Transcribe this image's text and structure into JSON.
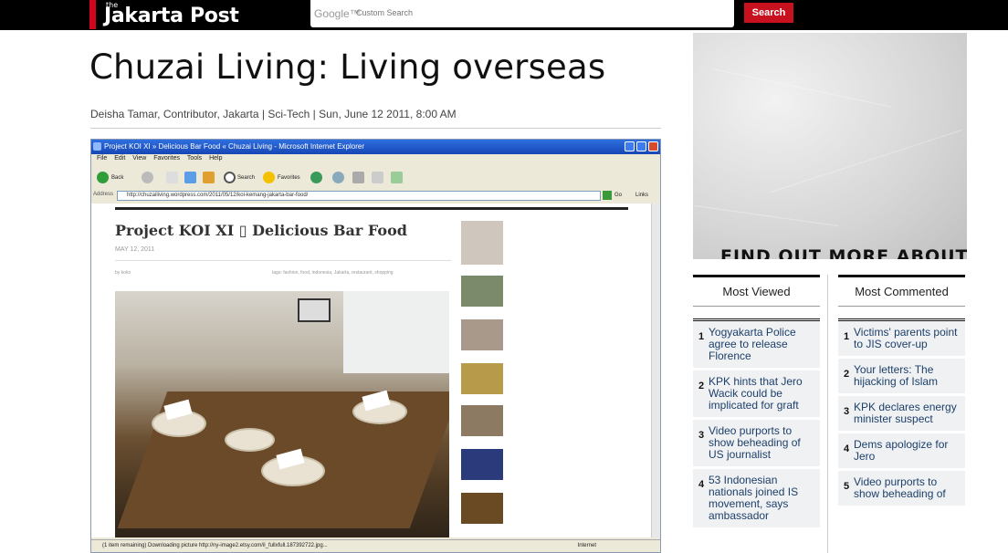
{
  "header": {
    "logo_the": "the",
    "logo_name": "Jakarta Post",
    "search_brand": "Google™",
    "search_placeholder": "Custom Search",
    "search_button": "Search",
    "accent": "#d1061c"
  },
  "article": {
    "title": "Chuzai Living: Living overseas",
    "byline": "Deisha Tamar, Contributor, Jakarta | Sci-Tech | Sun, June 12 2011, 8:00 AM"
  },
  "screenshot": {
    "window_title": "Project KOI XI » Delicious Bar Food « Chuzai Living - Microsoft Internet Explorer",
    "menu": "File Edit View Favorites Tools Help",
    "toolbar": {
      "back": "Back",
      "search": "Search",
      "favorites": "Favorites"
    },
    "address_label": "Address",
    "address": "http://chuzailiving.wordpress.com/2011/05/12/koi-kemang-jakarta-bar-food/",
    "go_label": "Go",
    "links_label": "Links",
    "post_title": "Project KOI XI ▯ Delicious Bar Food",
    "post_date": "MAY 12, 2011",
    "post_by": "by koko",
    "post_tags": "tags: fashion, food, indonesia, Jakarta, restaurant, shopping",
    "status": "(1 item remaining) Downloading picture http://ny-image2.etsy.com/il_fullxfull.187392722.jpg...",
    "status_zone": "Internet"
  },
  "ad": {
    "tagline": "FIND OUT MORE ABOUT"
  },
  "most_viewed": {
    "heading": "Most Viewed",
    "items": [
      {
        "num": "1",
        "text": "Yogyakarta Police agree to release Florence"
      },
      {
        "num": "2",
        "text": "KPK hints that Jero Wacik could be implicated for graft"
      },
      {
        "num": "3",
        "text": "Video purports to show beheading of US journalist"
      },
      {
        "num": "4",
        "text": "53 Indonesian nationals joined IS movement, says ambassador"
      }
    ]
  },
  "most_commented": {
    "heading": "Most Commented",
    "items": [
      {
        "num": "1",
        "text": "Victims' parents point to JIS cover-up"
      },
      {
        "num": "2",
        "text": "Your letters: The hijacking of Islam"
      },
      {
        "num": "3",
        "text": "KPK declares energy minister suspect"
      },
      {
        "num": "4",
        "text": "Dems apologize for Jero"
      },
      {
        "num": "5",
        "text": "Video purports to show beheading of"
      }
    ]
  }
}
